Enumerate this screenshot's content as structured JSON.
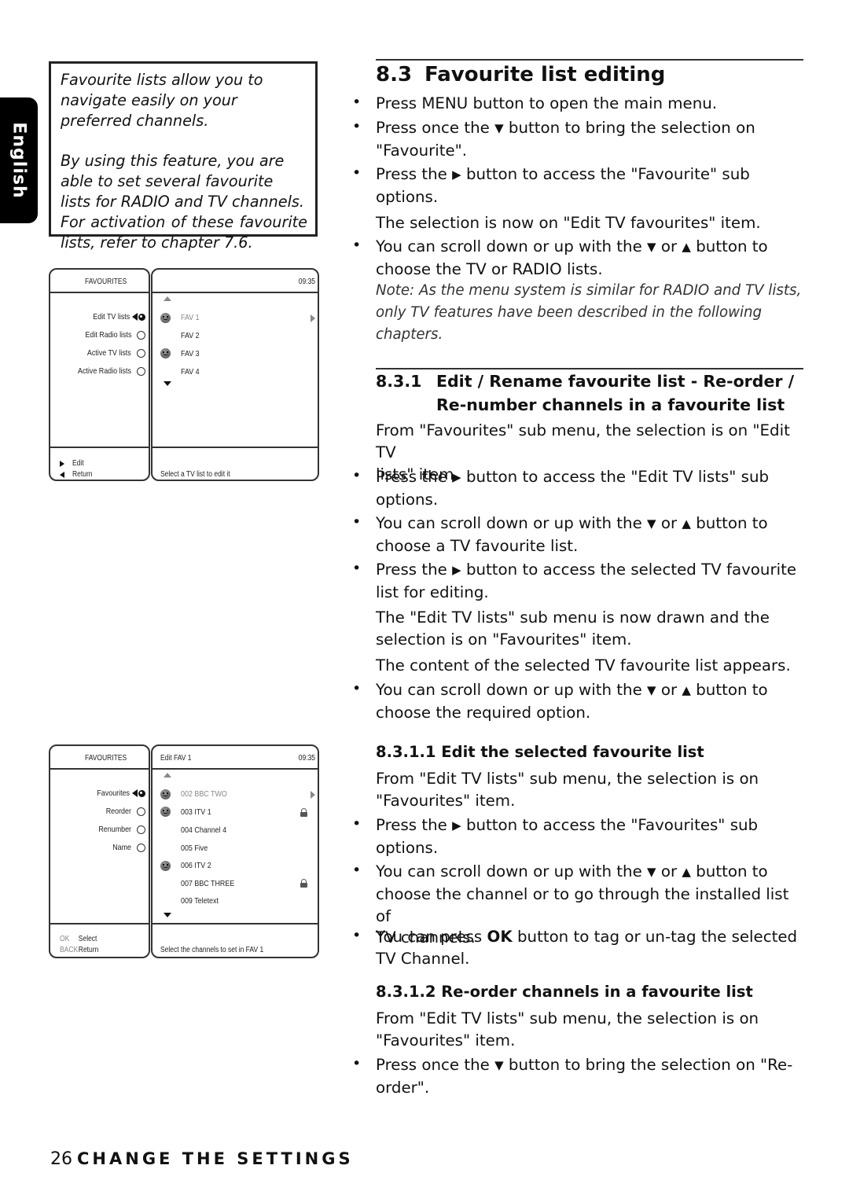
{
  "language_tab": "English",
  "intro_box": {
    "para1": "Favourite lists allow you to navigate easily on your preferred channels.",
    "para2": "By using this feature, you are able to set several favourite lists for RADIO and TV channels.",
    "para3": "For activation of these favourite lists, refer to chapter 7.6."
  },
  "screen1": {
    "left_header": "FAVOURITES",
    "right_header": "",
    "clock": "09:35",
    "menu_items": [
      {
        "label": "Edit TV lists",
        "selected": true
      },
      {
        "label": "Edit Radio lists",
        "selected": false
      },
      {
        "label": "Active TV lists",
        "selected": false
      },
      {
        "label": "Active Radio lists",
        "selected": false
      }
    ],
    "list_items": [
      {
        "label": "FAV 1",
        "tagged": true,
        "highlighted": true,
        "locked": false
      },
      {
        "label": "FAV 2",
        "tagged": false,
        "highlighted": false,
        "locked": false
      },
      {
        "label": "FAV 3",
        "tagged": true,
        "highlighted": false,
        "locked": false
      },
      {
        "label": "FAV 4",
        "tagged": false,
        "highlighted": false,
        "locked": false
      }
    ],
    "footer_keys": [
      {
        "key": "right-arrow",
        "label": "Edit"
      },
      {
        "key": "left-arrow",
        "label": "Return"
      }
    ],
    "status": "Select a TV list to edit it"
  },
  "screen2": {
    "left_header": "FAVOURITES",
    "right_header": "Edit FAV 1",
    "clock": "09:35",
    "menu_items": [
      {
        "label": "Favourites",
        "selected": true
      },
      {
        "label": "Reorder",
        "selected": false
      },
      {
        "label": "Renumber",
        "selected": false
      },
      {
        "label": "Name",
        "selected": false
      }
    ],
    "list_items": [
      {
        "label": "002 BBC TWO",
        "tagged": true,
        "highlighted": true,
        "locked": false
      },
      {
        "label": "003 ITV 1",
        "tagged": true,
        "highlighted": false,
        "locked": true
      },
      {
        "label": "004 Channel 4",
        "tagged": false,
        "highlighted": false,
        "locked": false
      },
      {
        "label": "005 Five",
        "tagged": false,
        "highlighted": false,
        "locked": false
      },
      {
        "label": "006 ITV 2",
        "tagged": true,
        "highlighted": false,
        "locked": false
      },
      {
        "label": "007 BBC THREE",
        "tagged": false,
        "highlighted": false,
        "locked": true
      },
      {
        "label": "009 Teletext",
        "tagged": false,
        "highlighted": false,
        "locked": false
      }
    ],
    "footer_keys": [
      {
        "key": "OK",
        "label": "Select"
      },
      {
        "key": "BACK",
        "label": "Return"
      }
    ],
    "status": "Select the channels to set in FAV 1"
  },
  "section_8_3": {
    "number": "8.3",
    "title": "Favourite list editing",
    "b1": "Press MENU button to open the main menu.",
    "b2_a": "Press once the ",
    "b2_b": " button to bring the selection on",
    "b2_c": "\"Favourite\".",
    "b3_a": "Press the ",
    "b3_b": " button to access the \"Favourite\" sub",
    "b3_c": "options.",
    "p1": "The selection is now on \"Edit TV favourites\" item.",
    "b4_a": "You can scroll down or up with the ",
    "b4_or": " or ",
    "b4_b": " button to",
    "b4_c": "choose the TV or RADIO lists.",
    "note1": "Note: As the menu system is similar for RADIO and TV lists,",
    "note2": "only TV features have been described in the following chapters."
  },
  "section_8_3_1": {
    "number": "8.3.1",
    "title_line1": "Edit / Rename favourite list - Re-order /",
    "title_line2": "Re-number channels in a favourite list",
    "p1_l1": "From \"Favourites\" sub menu, the selection is on \"Edit TV",
    "p1_l2": "lists\" item.",
    "b1_a": "Press the ",
    "b1_b": " button to access the \"Edit TV lists\" sub",
    "b1_c": "options.",
    "b2_a": "You can scroll down or up with the ",
    "b2_or": " or ",
    "b2_b": " button to",
    "b2_c": "choose a TV favourite list.",
    "b3_a": "Press the ",
    "b3_b": " button to access the selected TV favourite",
    "b3_c": "list for editing.",
    "p2_l1": "The \"Edit TV lists\" sub menu is now drawn and the",
    "p2_l2": "selection is on \"Favourites\" item.",
    "p3": "The content of the selected TV favourite list appears.",
    "b4_a": "You can scroll down or up with the ",
    "b4_or": " or ",
    "b4_b": " button to",
    "b4_c": "choose the required option."
  },
  "section_8_3_1_1": {
    "title": "8.3.1.1 Edit the selected favourite list",
    "p1_l1": "From \"Edit TV lists\" sub menu, the selection is on",
    "p1_l2": "\"Favourites\" item.",
    "b1_a": "Press the ",
    "b1_b": " button to access the \"Favourites\" sub",
    "b1_c": "options.",
    "b2_a": "You can scroll down or up with the ",
    "b2_or": " or ",
    "b2_b": " button to",
    "b2_c": "choose the channel or to go through the installed list of",
    "b2_d": "TV channels.",
    "b3_a": "You can press ",
    "b3_bold": "OK",
    "b3_b": " button to tag or un-tag the selected",
    "b3_c": "TV Channel."
  },
  "section_8_3_1_2": {
    "title": "8.3.1.2 Re-order channels in a favourite list",
    "p1_l1": "From \"Edit TV lists\" sub menu, the selection is on",
    "p1_l2": "\"Favourites\" item.",
    "b1_a": "Press once the ",
    "b1_b": " button to bring the selection on \"Re-",
    "b1_c": "order\"."
  },
  "glyphs": {
    "down": "▼",
    "up": "▲",
    "right": "▶",
    "bullet": "•"
  },
  "footer": {
    "page_number": "26",
    "chapter_title": "CHANGE THE SETTINGS"
  }
}
